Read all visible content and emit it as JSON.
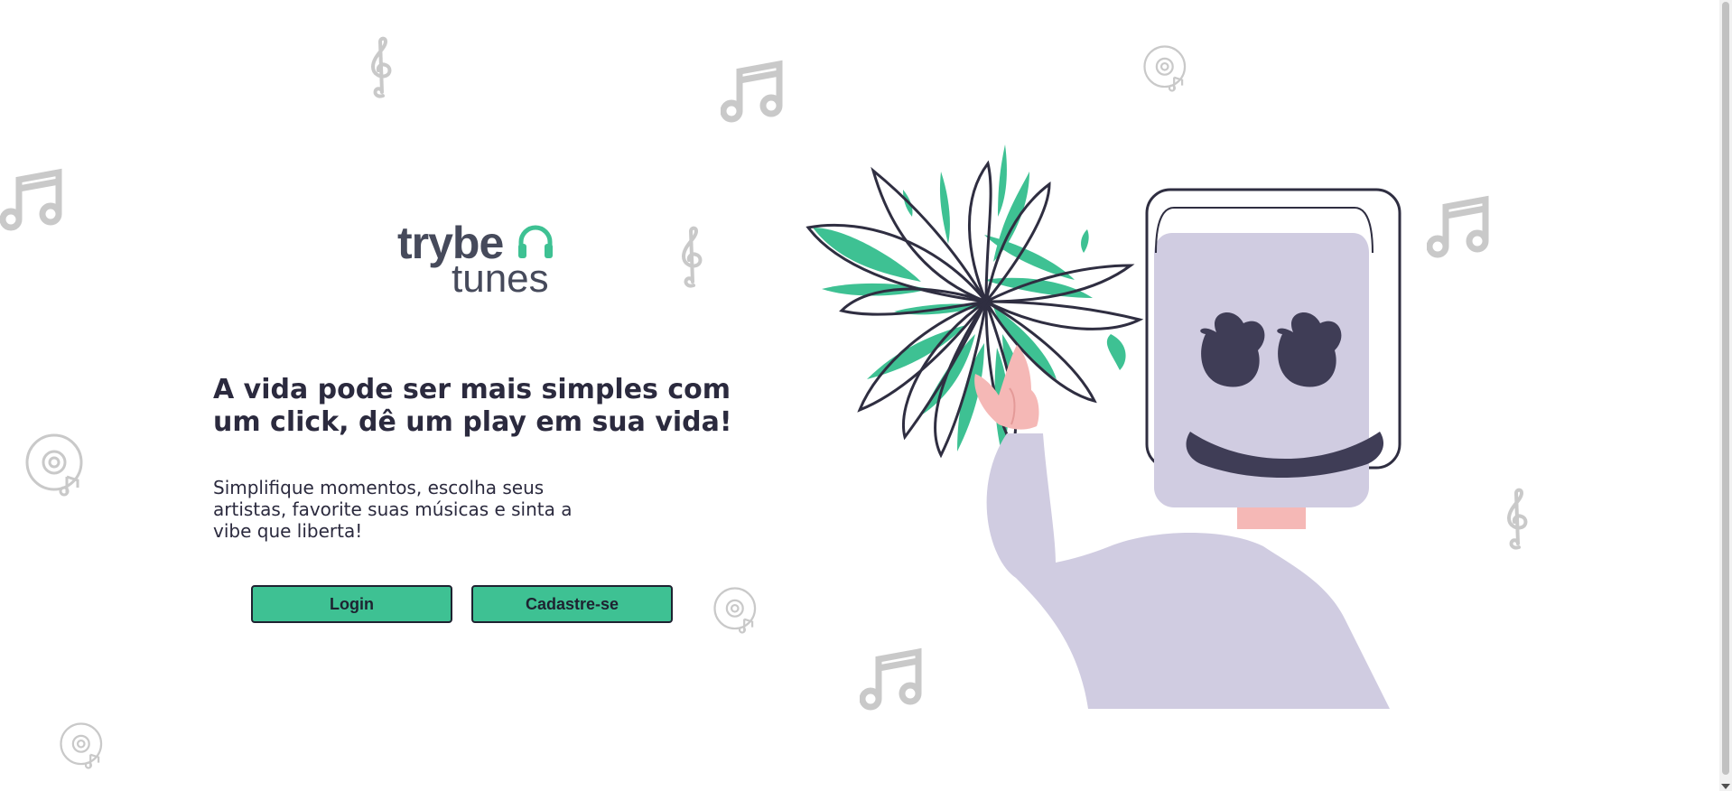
{
  "logo": {
    "word1": "trybe",
    "word2": "tunes",
    "icon": "headphones-icon"
  },
  "hero": {
    "headline": "A vida pode ser mais simples com um click, dê um play em sua vida!",
    "subtext": "Simplifique momentos, escolha seus artistas, favorite suas músicas e sinta a vibe que liberta!"
  },
  "buttons": {
    "login": "Login",
    "signup": "Cadastre-se"
  },
  "colors": {
    "accent": "#3ec193",
    "text_dark": "#2b2a3e",
    "logo_text": "#464a5b",
    "illustration_purple": "#d0cce1",
    "skin": "#f5b8b6",
    "decor_gray": "#c8c8c8"
  },
  "decorations": [
    "treble-clef-icon",
    "music-note-icon",
    "vinyl-disc-icon"
  ],
  "illustration": "person-with-marshmello-helmet-and-burst"
}
